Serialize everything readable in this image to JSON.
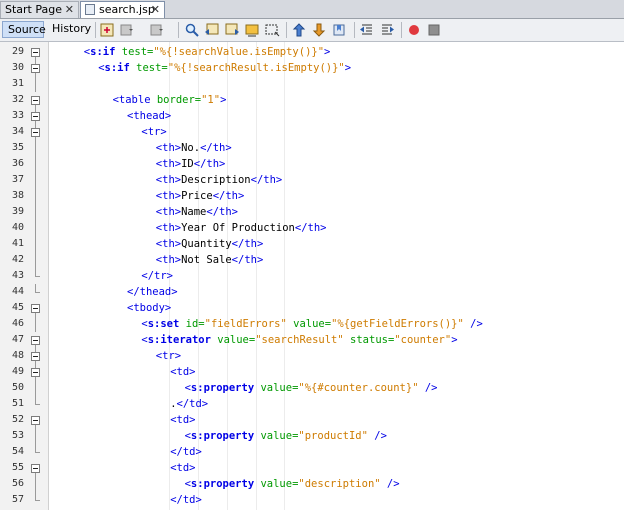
{
  "tabs": [
    {
      "label": "Start Page",
      "active": false
    },
    {
      "label": "search.jsp",
      "active": true
    }
  ],
  "toolbar": {
    "views": [
      "Source",
      "History"
    ],
    "icons": [
      "last-edit-icon",
      "back-icon",
      "forward-icon",
      "find-icon",
      "find-previous-icon",
      "find-next-icon",
      "toggle-highlight-icon",
      "toggle-rect-select-icon",
      "previous-bookmark-icon",
      "next-bookmark-icon",
      "toggle-bookmark-icon",
      "shift-left-icon",
      "shift-right-icon",
      "start-macro-icon",
      "stop-macro-icon"
    ]
  },
  "colors": {
    "tag": "#0000e6",
    "attr": "#009900",
    "value": "#ce7b00",
    "record": "#e0393e"
  },
  "lines": [
    {
      "no": "29",
      "indent": 4,
      "fold": "start",
      "tokens": [
        [
          "tg",
          "<"
        ],
        [
          "sn",
          "s:if"
        ],
        [
          "at",
          " test="
        ],
        [
          "av",
          "\"%{!searchValue.isEmpty()}\""
        ],
        [
          "tg",
          ">"
        ]
      ]
    },
    {
      "no": "30",
      "indent": 6,
      "fold": "start",
      "tokens": [
        [
          "tg",
          "<"
        ],
        [
          "sn",
          "s:if"
        ],
        [
          "at",
          " test="
        ],
        [
          "av",
          "\"%{!searchResult.isEmpty()}\""
        ],
        [
          "tg",
          ">"
        ]
      ]
    },
    {
      "no": "31",
      "indent": 0,
      "fold": "",
      "tokens": []
    },
    {
      "no": "32",
      "indent": 8,
      "fold": "start",
      "tokens": [
        [
          "tg",
          "<table"
        ],
        [
          "at",
          " border="
        ],
        [
          "av",
          "\"1\""
        ],
        [
          "tg",
          ">"
        ]
      ]
    },
    {
      "no": "33",
      "indent": 10,
      "fold": "start",
      "tokens": [
        [
          "tg",
          "<thead>"
        ]
      ]
    },
    {
      "no": "34",
      "indent": 12,
      "fold": "start",
      "tokens": [
        [
          "tg",
          "<tr>"
        ]
      ]
    },
    {
      "no": "35",
      "indent": 14,
      "fold": "",
      "tokens": [
        [
          "tg",
          "<th>"
        ],
        [
          "bk",
          "No."
        ],
        [
          "tg",
          "</th>"
        ]
      ]
    },
    {
      "no": "36",
      "indent": 14,
      "fold": "",
      "tokens": [
        [
          "tg",
          "<th>"
        ],
        [
          "bk",
          "ID"
        ],
        [
          "tg",
          "</th>"
        ]
      ]
    },
    {
      "no": "37",
      "indent": 14,
      "fold": "",
      "tokens": [
        [
          "tg",
          "<th>"
        ],
        [
          "bk",
          "Description"
        ],
        [
          "tg",
          "</th>"
        ]
      ]
    },
    {
      "no": "38",
      "indent": 14,
      "fold": "",
      "tokens": [
        [
          "tg",
          "<th>"
        ],
        [
          "bk",
          "Price"
        ],
        [
          "tg",
          "</th>"
        ]
      ]
    },
    {
      "no": "39",
      "indent": 14,
      "fold": "",
      "tokens": [
        [
          "tg",
          "<th>"
        ],
        [
          "bk",
          "Name"
        ],
        [
          "tg",
          "</th>"
        ]
      ]
    },
    {
      "no": "40",
      "indent": 14,
      "fold": "",
      "tokens": [
        [
          "tg",
          "<th>"
        ],
        [
          "bk",
          "Year Of Production"
        ],
        [
          "tg",
          "</th>"
        ]
      ]
    },
    {
      "no": "41",
      "indent": 14,
      "fold": "",
      "tokens": [
        [
          "tg",
          "<th>"
        ],
        [
          "bk",
          "Quantity"
        ],
        [
          "tg",
          "</th>"
        ]
      ]
    },
    {
      "no": "42",
      "indent": 14,
      "fold": "",
      "tokens": [
        [
          "tg",
          "<th>"
        ],
        [
          "bk",
          "Not Sale"
        ],
        [
          "tg",
          "</th>"
        ]
      ]
    },
    {
      "no": "43",
      "indent": 12,
      "fold": "end",
      "tokens": [
        [
          "tg",
          "</tr>"
        ]
      ]
    },
    {
      "no": "44",
      "indent": 10,
      "fold": "end",
      "tokens": [
        [
          "tg",
          "</thead>"
        ]
      ]
    },
    {
      "no": "45",
      "indent": 10,
      "fold": "start",
      "tokens": [
        [
          "tg",
          "<tbody>"
        ]
      ]
    },
    {
      "no": "46",
      "indent": 12,
      "fold": "",
      "tokens": [
        [
          "tg",
          "<"
        ],
        [
          "sn",
          "s:set"
        ],
        [
          "at",
          " id="
        ],
        [
          "av",
          "\"fieldErrors\""
        ],
        [
          "at",
          " value="
        ],
        [
          "av",
          "\"%{getFieldErrors()}\""
        ],
        [
          "tg",
          " />"
        ]
      ]
    },
    {
      "no": "47",
      "indent": 12,
      "fold": "start",
      "tokens": [
        [
          "tg",
          "<"
        ],
        [
          "sn",
          "s:iterator"
        ],
        [
          "at",
          " value="
        ],
        [
          "av",
          "\"searchResult\""
        ],
        [
          "at",
          " status="
        ],
        [
          "av",
          "\"counter\""
        ],
        [
          "tg",
          ">"
        ]
      ]
    },
    {
      "no": "48",
      "indent": 14,
      "fold": "start",
      "tokens": [
        [
          "tg",
          "<tr>"
        ]
      ]
    },
    {
      "no": "49",
      "indent": 16,
      "fold": "start",
      "tokens": [
        [
          "tg",
          "<td>"
        ]
      ]
    },
    {
      "no": "50",
      "indent": 18,
      "fold": "",
      "tokens": [
        [
          "tg",
          "<"
        ],
        [
          "sn",
          "s:property"
        ],
        [
          "at",
          " value="
        ],
        [
          "av",
          "\"%{#counter.count}\""
        ],
        [
          "tg",
          " />"
        ]
      ]
    },
    {
      "no": "51",
      "indent": 16,
      "fold": "end",
      "tokens": [
        [
          "bk",
          "."
        ],
        [
          "tg",
          "</td>"
        ]
      ]
    },
    {
      "no": "52",
      "indent": 16,
      "fold": "start",
      "tokens": [
        [
          "tg",
          "<td>"
        ]
      ]
    },
    {
      "no": "53",
      "indent": 18,
      "fold": "",
      "tokens": [
        [
          "tg",
          "<"
        ],
        [
          "sn",
          "s:property"
        ],
        [
          "at",
          " value="
        ],
        [
          "av",
          "\"productId\""
        ],
        [
          "tg",
          " />"
        ]
      ]
    },
    {
      "no": "54",
      "indent": 16,
      "fold": "end",
      "tokens": [
        [
          "tg",
          "</td>"
        ]
      ]
    },
    {
      "no": "55",
      "indent": 16,
      "fold": "start",
      "tokens": [
        [
          "tg",
          "<td>"
        ]
      ]
    },
    {
      "no": "56",
      "indent": 18,
      "fold": "",
      "tokens": [
        [
          "tg",
          "<"
        ],
        [
          "sn",
          "s:property"
        ],
        [
          "at",
          " value="
        ],
        [
          "av",
          "\"description\""
        ],
        [
          "tg",
          " />"
        ]
      ]
    },
    {
      "no": "57",
      "indent": 16,
      "fold": "end",
      "tokens": [
        [
          "tg",
          "</td>"
        ]
      ]
    }
  ]
}
